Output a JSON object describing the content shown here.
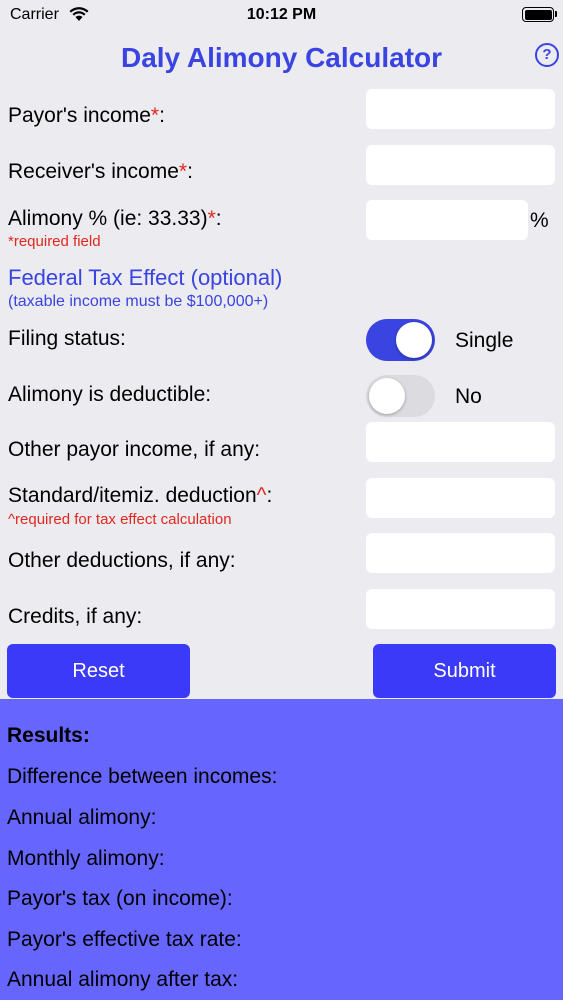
{
  "status_bar": {
    "carrier": "Carrier",
    "time": "10:12 PM"
  },
  "header": {
    "title": "Daly Alimony Calculator",
    "help": "?"
  },
  "form": {
    "payor_income": {
      "label": "Payor's income",
      "marker": "*",
      "suffix": ":",
      "value": ""
    },
    "receiver_income": {
      "label": "Receiver's income",
      "marker": "*",
      "suffix": ":",
      "value": ""
    },
    "alimony_pct": {
      "label": "Alimony % (ie: 33.33)",
      "marker": "*",
      "suffix": ":",
      "value": "",
      "unit": "%"
    },
    "required_note": "*required field",
    "federal_title": "Federal Tax Effect (optional)",
    "federal_subtitle": "(taxable income must be $100,000+)",
    "filing_status": {
      "label": "Filing status:",
      "state": "on",
      "value_label": "Single"
    },
    "alimony_deductible": {
      "label": "Alimony is deductible:",
      "state": "off",
      "value_label": "No"
    },
    "other_payor_income": {
      "label": "Other payor income, if any:",
      "value": ""
    },
    "std_deduction": {
      "label": "Standard/itemiz. deduction",
      "marker": "^",
      "suffix": ":",
      "value": ""
    },
    "tax_note": "^required for tax effect calculation",
    "other_deductions": {
      "label": "Other deductions, if any:",
      "value": ""
    },
    "credits": {
      "label": "Credits, if any:",
      "value": ""
    }
  },
  "buttons": {
    "reset": "Reset",
    "submit": "Submit"
  },
  "results": {
    "title": "Results:",
    "lines": [
      "Difference between incomes:",
      "Annual alimony:",
      "Monthly alimony:",
      "Payor's tax (on income):",
      "Payor's effective tax rate:",
      "Annual alimony after tax:"
    ]
  },
  "colors": {
    "accent": "#3a44e0",
    "button": "#3a3af8",
    "results_bg": "#6666ff",
    "required": "#e0281f",
    "background": "#ebebf0"
  }
}
